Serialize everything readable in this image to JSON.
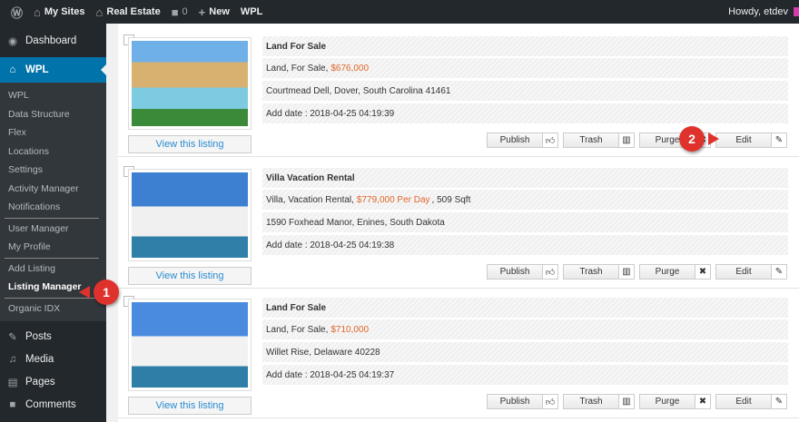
{
  "adminbar": {
    "my_sites": "My Sites",
    "site": "Real Estate",
    "comments": "0",
    "new": "New",
    "wpl": "WPL",
    "howdy": "Howdy, etdev"
  },
  "sidebar": {
    "dashboard": "Dashboard",
    "wpl": "WPL",
    "submenu": [
      "WPL",
      "Data Structure",
      "Flex",
      "Locations",
      "Settings",
      "Activity Manager",
      "Notifications",
      "User Manager",
      "My Profile",
      "Add Listing",
      "Listing Manager",
      "Organic IDX"
    ],
    "posts": "Posts",
    "media": "Media",
    "pages": "Pages",
    "comments": "Comments"
  },
  "callouts": [
    "1",
    "2"
  ],
  "buttons": {
    "view": "View this listing",
    "publish": "Publish",
    "trash": "Trash",
    "purge": "Purge",
    "edit": "Edit"
  },
  "listings": [
    {
      "title": "Land For Sale",
      "type_prefix": "Land, For Sale,",
      "price": "$676,000",
      "type_suffix": "",
      "address": "Courtmead Dell, Dover, South Carolina 41461",
      "date_label": "Add date :",
      "date": "2018-04-25 04:19:39"
    },
    {
      "title": "Villa Vacation Rental",
      "type_prefix": "Villa, Vacation Rental,",
      "price": "$779,000 Per Day",
      "type_suffix": ", 509 Sqft",
      "address": "1590 Foxhead Manor, Enines, South Dakota",
      "date_label": "Add date :",
      "date": "2018-04-25 04:19:38"
    },
    {
      "title": "Land For Sale",
      "type_prefix": "Land, For Sale,",
      "price": "$710,000",
      "type_suffix": "",
      "address": "Willet Rise, Delaware 40228",
      "date_label": "Add date :",
      "date": "2018-04-25 04:19:37"
    }
  ]
}
